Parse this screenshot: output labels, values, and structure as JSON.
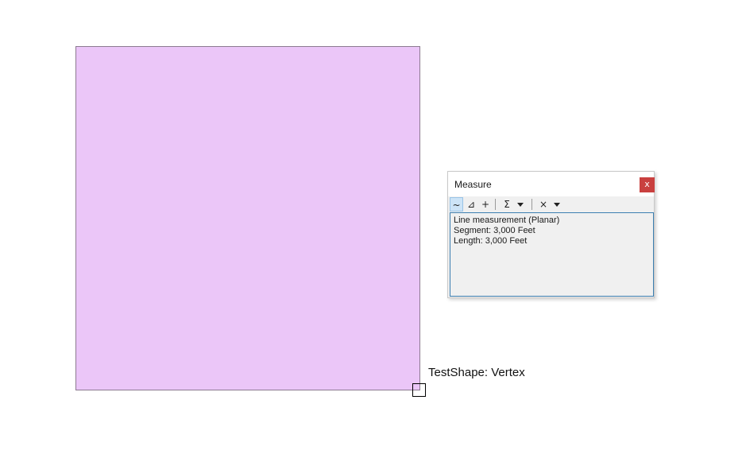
{
  "map": {
    "snap_tip": "TestShape: Vertex",
    "polygon_fill": "#ebc6f8",
    "polygon_outline": "#8c7a91"
  },
  "measure_window": {
    "title": "Measure",
    "close_label": "x",
    "toolbar": {
      "measure_line_icon": "~",
      "measure_area_icon": "⊿",
      "measure_feature_icon": "+",
      "sum_icon": "Σ",
      "clear_icon": "×"
    },
    "results": {
      "line1": "Line measurement (Planar)",
      "line2": "Segment: 3,000 Feet",
      "line3": "Length: 3,000 Feet"
    }
  }
}
